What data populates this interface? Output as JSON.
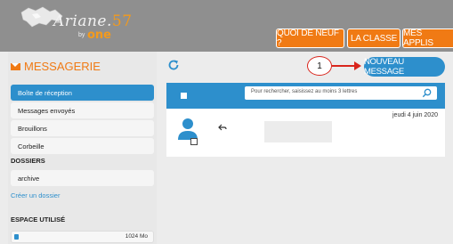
{
  "header": {
    "logo": {
      "name": "Ariane.57",
      "name_main": "Ariane.",
      "name_num": "57",
      "sub": "by",
      "brand": "one"
    },
    "nav": [
      {
        "label": "QUOI DE NEUF ?"
      },
      {
        "label": "LA CLASSE"
      },
      {
        "label": "MES APPLIS"
      }
    ]
  },
  "sidebar": {
    "title": "MESSAGERIE",
    "folders": [
      {
        "label": "Boîte de réception",
        "active": true
      },
      {
        "label": "Messages envoyés",
        "active": false
      },
      {
        "label": "Brouillons",
        "active": false
      },
      {
        "label": "Corbeille",
        "active": false
      }
    ],
    "dossiers_title": "DOSSIERS",
    "custom_folders": [
      {
        "label": "archive"
      }
    ],
    "create_folder": "Créer un dossier",
    "storage_title": "ESPACE UTILISÉ",
    "storage_value": "1024 Mo",
    "storage_fill_fraction": 0.03
  },
  "main": {
    "step_label": "1",
    "new_message": "NOUVEAU MESSAGE",
    "search_placeholder": "Pour rechercher, saisissez au moins 3 lettres",
    "messages": [
      {
        "date": "jeudi 4 juin 2020"
      }
    ]
  },
  "colors": {
    "accent_orange": "#f07a14",
    "accent_blue": "#2d8fcc",
    "annotation_red": "#d9251c"
  }
}
